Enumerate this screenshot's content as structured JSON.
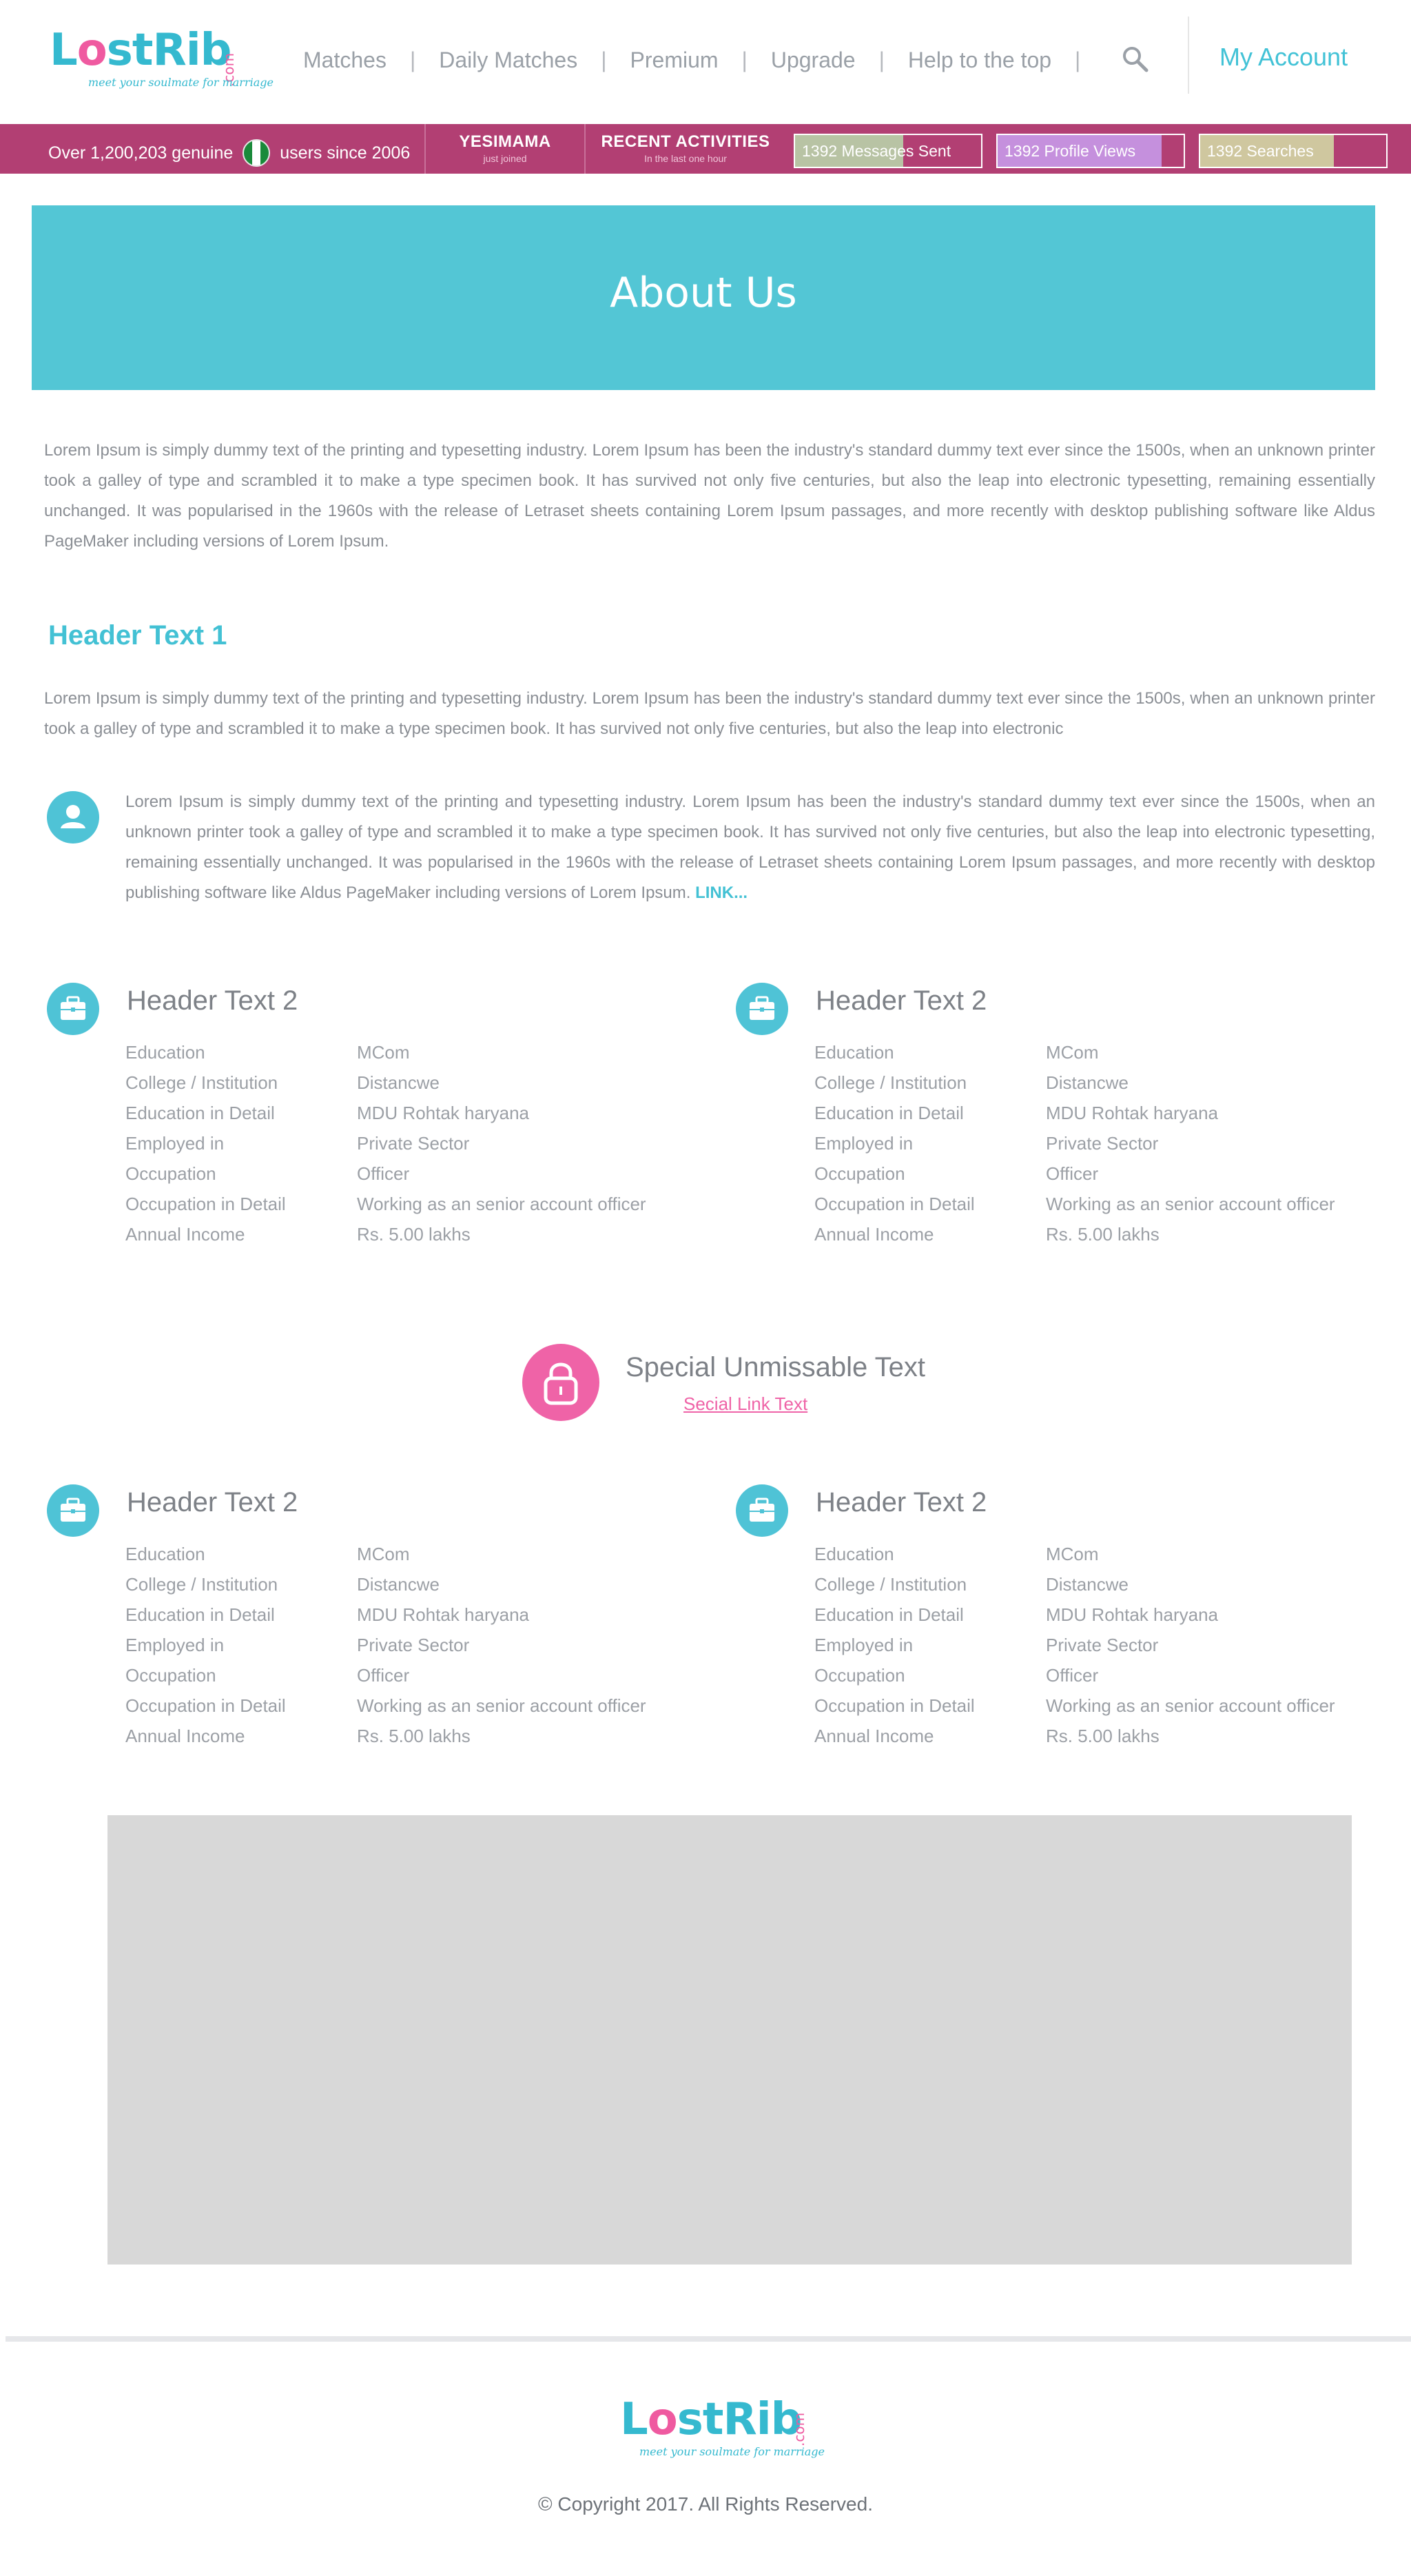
{
  "brand": {
    "name_prefix": "L",
    "name_o": "o",
    "name_suffix": "stRib",
    "dotcom": ".com",
    "tagline": "meet your soulmate for marriage"
  },
  "nav": {
    "items": [
      "Matches",
      "Daily Matches",
      "Premium",
      "Upgrade",
      "Help to the top"
    ],
    "account_label": "My Account"
  },
  "status": {
    "users_prefix": "Over 1,200,203 genuine",
    "users_suffix": "users since 2006",
    "member_name": "YESIMAMA",
    "member_note": "just joined",
    "recent_title": "RECENT ACTIVITIES",
    "recent_note": "In the last one hour",
    "meters": [
      {
        "label": "1392 Messages Sent",
        "fill": 0.58,
        "color": "#b8c3a4"
      },
      {
        "label": "1392 Profile Views",
        "fill": 0.88,
        "color": "#c590dd"
      },
      {
        "label": "1392 Searches",
        "fill": 0.72,
        "color": "#cfc79f"
      }
    ]
  },
  "banner": {
    "title": "About Us"
  },
  "intro": {
    "paragraph": "Lorem Ipsum is simply dummy text of the printing and typesetting industry. Lorem Ipsum has been the industry's standard dummy text ever since the 1500s, when an unknown printer took a galley of type and scrambled it to make a type specimen book. It has survived not only five centuries, but also the leap into electronic typesetting, remaining essentially unchanged. It was popularised in the 1960s with the release of Letraset sheets containing Lorem Ipsum passages, and more recently with desktop publishing software like Aldus PageMaker including versions of Lorem Ipsum."
  },
  "section1": {
    "header": "Header Text 1",
    "paragraph": "Lorem Ipsum is simply dummy text of the printing and typesetting industry. Lorem Ipsum has been the industry's standard dummy text ever since the 1500s, when an unknown printer took a galley of type and scrambled it to make a type specimen book. It has survived not only five centuries, but also the leap into electronic",
    "quote": "Lorem Ipsum is simply dummy text of the printing and typesetting industry. Lorem Ipsum has been the industry's standard dummy text ever since the 1500s, when an unknown printer took a galley of type and scrambled it to make a type specimen book. It has survived not only five centuries, but also the leap into electronic typesetting, remaining essentially unchanged. It was popularised in the 1960s with the release of Letraset sheets containing Lorem Ipsum passages, and more recently with desktop publishing software like Aldus PageMaker including versions of Lorem Ipsum.",
    "link": "LINK..."
  },
  "cards": [
    {
      "title": "Header Text 2",
      "rows": [
        {
          "k": "Education",
          "v": "MCom"
        },
        {
          "k": "College / Institution",
          "v": "Distancwe"
        },
        {
          "k": "Education in Detail",
          "v": "MDU Rohtak haryana"
        },
        {
          "k": "Employed in",
          "v": "Private Sector"
        },
        {
          "k": "Occupation",
          "v": "Officer"
        },
        {
          "k": "Occupation in Detail",
          "v": "Working as an senior account officer"
        },
        {
          "k": "Annual Income",
          "v": "Rs. 5.00 lakhs"
        }
      ]
    },
    {
      "title": "Header Text 2",
      "rows": [
        {
          "k": "Education",
          "v": "MCom"
        },
        {
          "k": "College / Institution",
          "v": "Distancwe"
        },
        {
          "k": "Education in Detail",
          "v": "MDU Rohtak haryana"
        },
        {
          "k": "Employed in",
          "v": "Private Sector"
        },
        {
          "k": "Occupation",
          "v": "Officer"
        },
        {
          "k": "Occupation in Detail",
          "v": "Working as an senior account officer"
        },
        {
          "k": "Annual Income",
          "v": "Rs. 5.00 lakhs"
        }
      ]
    },
    {
      "title": "Header Text 2",
      "rows": [
        {
          "k": "Education",
          "v": "MCom"
        },
        {
          "k": "College / Institution",
          "v": "Distancwe"
        },
        {
          "k": "Education in Detail",
          "v": "MDU Rohtak haryana"
        },
        {
          "k": "Employed in",
          "v": "Private Sector"
        },
        {
          "k": "Occupation",
          "v": "Officer"
        },
        {
          "k": "Occupation in Detail",
          "v": "Working as an senior account officer"
        },
        {
          "k": "Annual Income",
          "v": "Rs. 5.00 lakhs"
        }
      ]
    },
    {
      "title": "Header Text 2",
      "rows": [
        {
          "k": "Education",
          "v": "MCom"
        },
        {
          "k": "College / Institution",
          "v": "Distancwe"
        },
        {
          "k": "Education in Detail",
          "v": "MDU Rohtak haryana"
        },
        {
          "k": "Employed in",
          "v": "Private Sector"
        },
        {
          "k": "Occupation",
          "v": "Officer"
        },
        {
          "k": "Occupation in Detail",
          "v": "Working as an senior account officer"
        },
        {
          "k": "Annual Income",
          "v": "Rs. 5.00 lakhs"
        }
      ]
    }
  ],
  "special": {
    "title": "Special Unmissable Text",
    "link": "Secial Link Text"
  },
  "footer": {
    "copyright": "© Copyright 2017. All Rights Reserved."
  },
  "colors": {
    "accent": "#43c1d4",
    "pink": "#ef63a7",
    "statusbar": "#b23f73"
  },
  "icons": [
    "search-icon",
    "flag-icon",
    "user-icon",
    "briefcase-icon",
    "lock-icon"
  ]
}
